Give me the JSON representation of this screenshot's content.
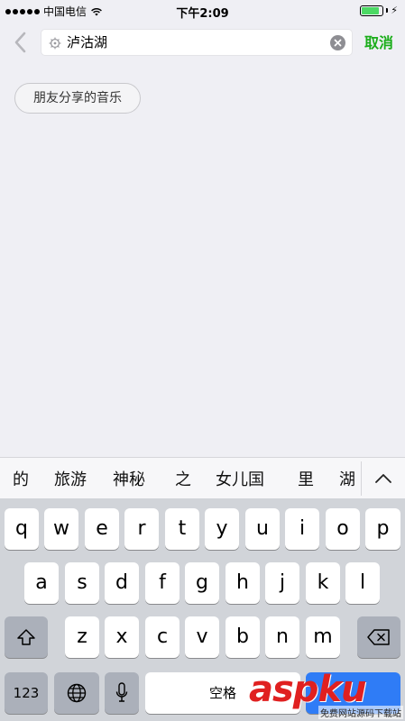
{
  "status_bar": {
    "carrier": "中国电信",
    "time": "下午2:09",
    "battery_level": 0.85
  },
  "search": {
    "query": "泸沽湖",
    "cancel_label": "取消"
  },
  "filter": {
    "chip_label": "朋友分享的音乐"
  },
  "candidates": [
    "的",
    "旅游",
    "神秘",
    "之",
    "女儿国",
    "里",
    "湖"
  ],
  "keyboard": {
    "row1": [
      "q",
      "w",
      "e",
      "r",
      "t",
      "y",
      "u",
      "i",
      "o",
      "p"
    ],
    "row2": [
      "a",
      "s",
      "d",
      "f",
      "g",
      "h",
      "j",
      "k",
      "l"
    ],
    "row3": [
      "z",
      "x",
      "c",
      "v",
      "b",
      "n",
      "m"
    ],
    "numbers_label": "123",
    "space_label": "空格"
  },
  "watermark": {
    "logo": "aspku",
    "caption": "免费网站源码下载站"
  },
  "colors": {
    "accent_green": "#1aad19",
    "battery_green": "#4cd964",
    "watermark_red": "#e02020"
  }
}
